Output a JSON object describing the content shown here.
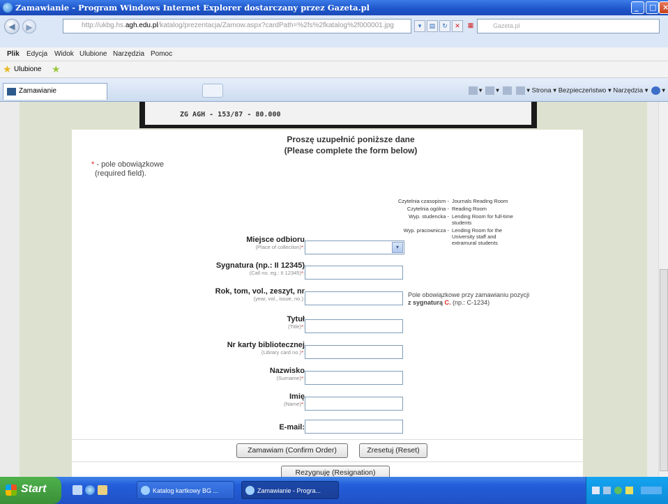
{
  "window": {
    "title": "Zamawianie - Program Windows Internet Explorer dostarczany przez Gazeta.pl"
  },
  "address": {
    "url_prefix": "http://ukbg.hs.",
    "url_domain": "agh.edu.pl",
    "url_rest": "/katalog/prezentacja/Zamow.aspx?cardPath=%2fs%2fkatalog%2f000001.jpg",
    "search_placeholder": "Gazeta.pl"
  },
  "menu": [
    "Plik",
    "Edycja",
    "Widok",
    "Ulubione",
    "Narzędzia",
    "Pomoc"
  ],
  "favorites": {
    "label": "Ulubione"
  },
  "tab": {
    "label": "Zamawianie"
  },
  "commands": {
    "page": "Strona ▾",
    "safety": "Bezpieczeństwo ▾",
    "tools": "Narzędzia ▾"
  },
  "card": {
    "code": "ZG AGH - 153/87 - 80.000"
  },
  "form": {
    "header_line1": "Proszę uzupełnić poniższe dane",
    "header_line2": "(Please complete the form below)",
    "required_note": "- pole obowiązkowe",
    "required_note_en": "(required field).",
    "asterisk": "*",
    "colon": ":",
    "legend": [
      {
        "key": "Czytelnia czasopism -",
        "value": "Journals Reading Room"
      },
      {
        "key": "Czytelnia ogólna -",
        "value": "Reading Room"
      },
      {
        "key": "Wyp. studencka -",
        "value": "Lending Room for full-time students"
      },
      {
        "key": "Wyp. pracownicza -",
        "value": "Lending Room for the University staff and extramural students"
      }
    ],
    "note_text": "Pole obowiązkowe przy zamawianiu pozycji",
    "note_bold": "z sygnaturą",
    "note_red": "C.",
    "note_tail": "(np.: C-1234)",
    "fields": [
      {
        "label": "Miejsce odbioru",
        "hint": "(Place of collection)",
        "required": true,
        "value": ""
      },
      {
        "label": "Sygnatura (np.: II 12345)",
        "hint": "(Call no. eg.: II 12345)",
        "required": true,
        "value": ""
      },
      {
        "label": "Rok, tom, vol., zeszyt, nr",
        "hint": "(year, vol., issue, no.)",
        "required": false,
        "value": ""
      },
      {
        "label": "Tytuł",
        "hint": "(Title)",
        "required": true,
        "value": ""
      },
      {
        "label": "Nr karty bibliotecznej",
        "hint": "(Library card no.)",
        "required": true,
        "value": ""
      },
      {
        "label": "Nazwisko",
        "hint": "(Surname)",
        "required": true,
        "value": ""
      },
      {
        "label": "Imię",
        "hint": "(Name)",
        "required": true,
        "value": ""
      },
      {
        "label": "E-mail:",
        "hint": "",
        "required": false,
        "value": ""
      }
    ],
    "confirm_button": "Zamawiam (Confirm Order)",
    "reset_button": "Zresetuj (Reset)",
    "resign_button": "Rezygnuję (Resignation)"
  },
  "taskbar": {
    "start": "Start",
    "tasks": [
      "Katalog kartkowy BG ...",
      "Zamawianie - Progra..."
    ]
  }
}
